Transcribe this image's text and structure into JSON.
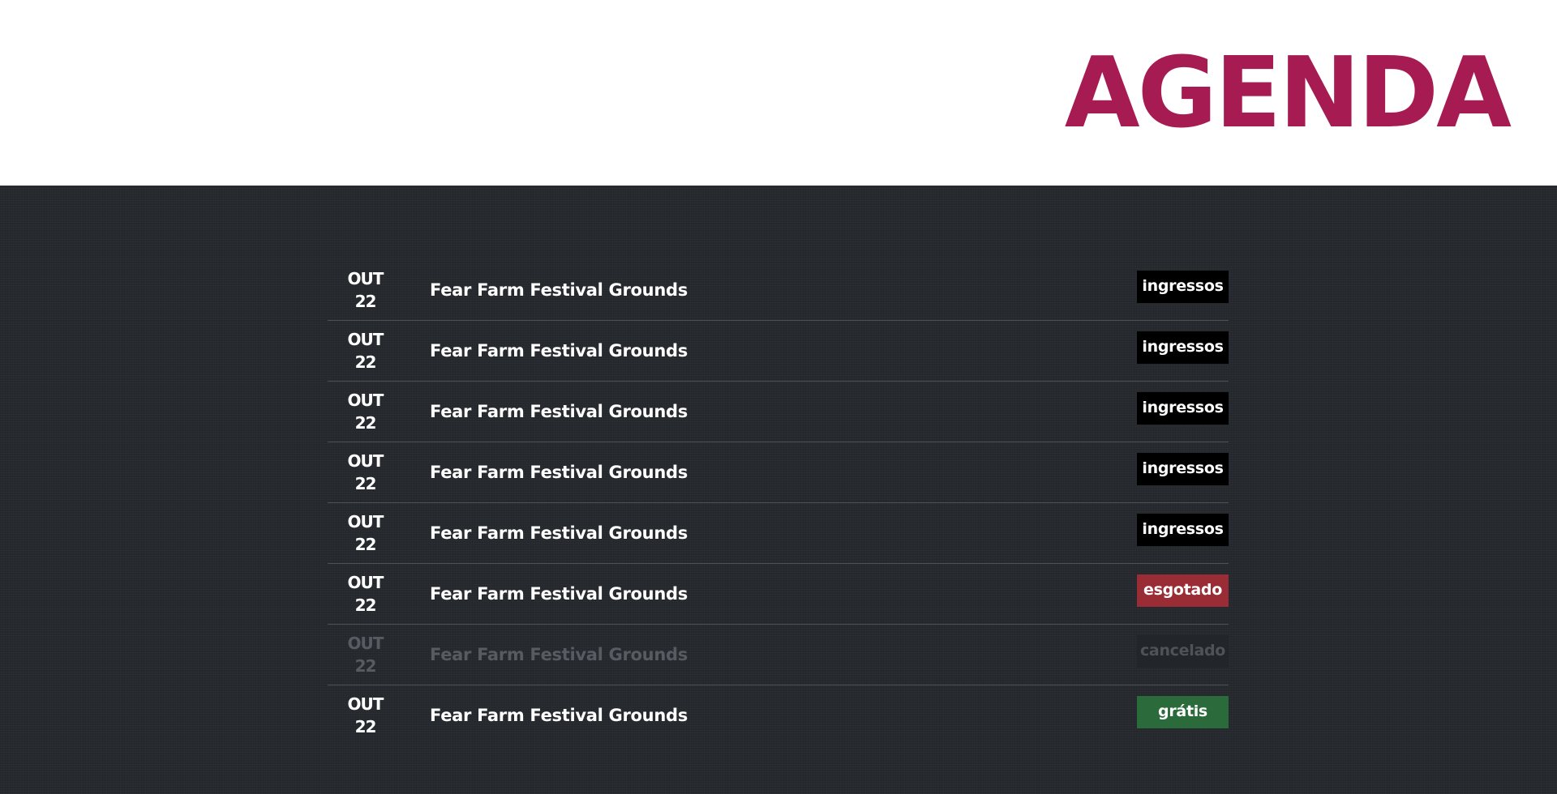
{
  "header": {
    "title": "AGENDA"
  },
  "events": [
    {
      "month": "OUT",
      "day": "22",
      "venue": "Fear Farm Festival Grounds",
      "status": "ingressos",
      "status_type": "tickets"
    },
    {
      "month": "OUT",
      "day": "22",
      "venue": "Fear Farm Festival Grounds",
      "status": "ingressos",
      "status_type": "tickets"
    },
    {
      "month": "OUT",
      "day": "22",
      "venue": "Fear Farm Festival Grounds",
      "status": "ingressos",
      "status_type": "tickets"
    },
    {
      "month": "OUT",
      "day": "22",
      "venue": "Fear Farm Festival Grounds",
      "status": "ingressos",
      "status_type": "tickets"
    },
    {
      "month": "OUT",
      "day": "22",
      "venue": "Fear Farm Festival Grounds",
      "status": "ingressos",
      "status_type": "tickets"
    },
    {
      "month": "OUT",
      "day": "22",
      "venue": "Fear Farm Festival Grounds",
      "status": "esgotado",
      "status_type": "soldout"
    },
    {
      "month": "OUT",
      "day": "22",
      "venue": "Fear Farm Festival Grounds",
      "status": "cancelado",
      "status_type": "cancelled"
    },
    {
      "month": "OUT",
      "day": "22",
      "venue": "Fear Farm Festival Grounds",
      "status": "grátis",
      "status_type": "free"
    }
  ],
  "colors": {
    "brand": "#a61c52",
    "background": "#262a2f",
    "tickets": "#000000",
    "soldout": "#9a2c35",
    "cancelled": "#222529",
    "free": "#2b6a3a"
  }
}
